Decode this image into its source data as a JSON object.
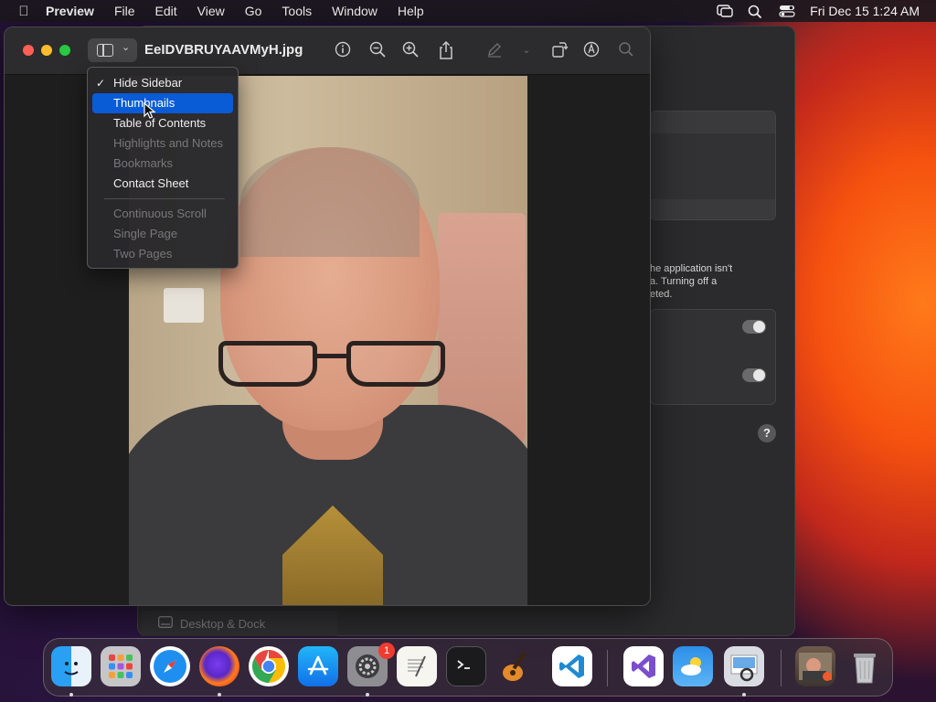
{
  "menubar": {
    "app_name": "Preview",
    "items": [
      "File",
      "Edit",
      "View",
      "Go",
      "Tools",
      "Window",
      "Help"
    ],
    "clock": "Fri Dec 15  1:24 AM"
  },
  "settings_window": {
    "partial_text": "he application isn't\na. Turning off a\neted.",
    "help_label": "?",
    "dock_section_label": "Desktop & Dock"
  },
  "preview": {
    "doc_title": "EeIDVBRUYAAVMyH.jpg",
    "toolbar_icons": [
      "info-icon",
      "zoom-out-icon",
      "zoom-in-icon",
      "share-icon",
      "markup-pen-icon",
      "rotate-icon",
      "annotate-icon",
      "search-icon"
    ]
  },
  "view_menu": {
    "items": [
      {
        "label": "Hide Sidebar",
        "checked": true
      },
      {
        "label": "Thumbnails",
        "selected": true
      },
      {
        "label": "Table of Contents"
      },
      {
        "label": "Highlights and Notes",
        "disabled": true
      },
      {
        "label": "Bookmarks",
        "disabled": true
      },
      {
        "label": "Contact Sheet"
      },
      {
        "label": "Continuous Scroll",
        "disabled": true
      },
      {
        "label": "Single Page",
        "disabled": true
      },
      {
        "label": "Two Pages",
        "disabled": true
      }
    ]
  },
  "dock": {
    "apps": [
      "Finder",
      "Launchpad",
      "Safari",
      "Firefox",
      "Chrome",
      "App Store",
      "System Settings",
      "TextEdit",
      "Terminal",
      "GarageBand",
      "VS Code",
      "Visual Studio",
      "Weather",
      "Preview",
      "Photo",
      "Trash"
    ],
    "settings_badge": "1"
  },
  "colors": {
    "accent": "#0a5bd6",
    "close": "#fe5f57",
    "minimize": "#febc2e",
    "zoom": "#28c840"
  }
}
